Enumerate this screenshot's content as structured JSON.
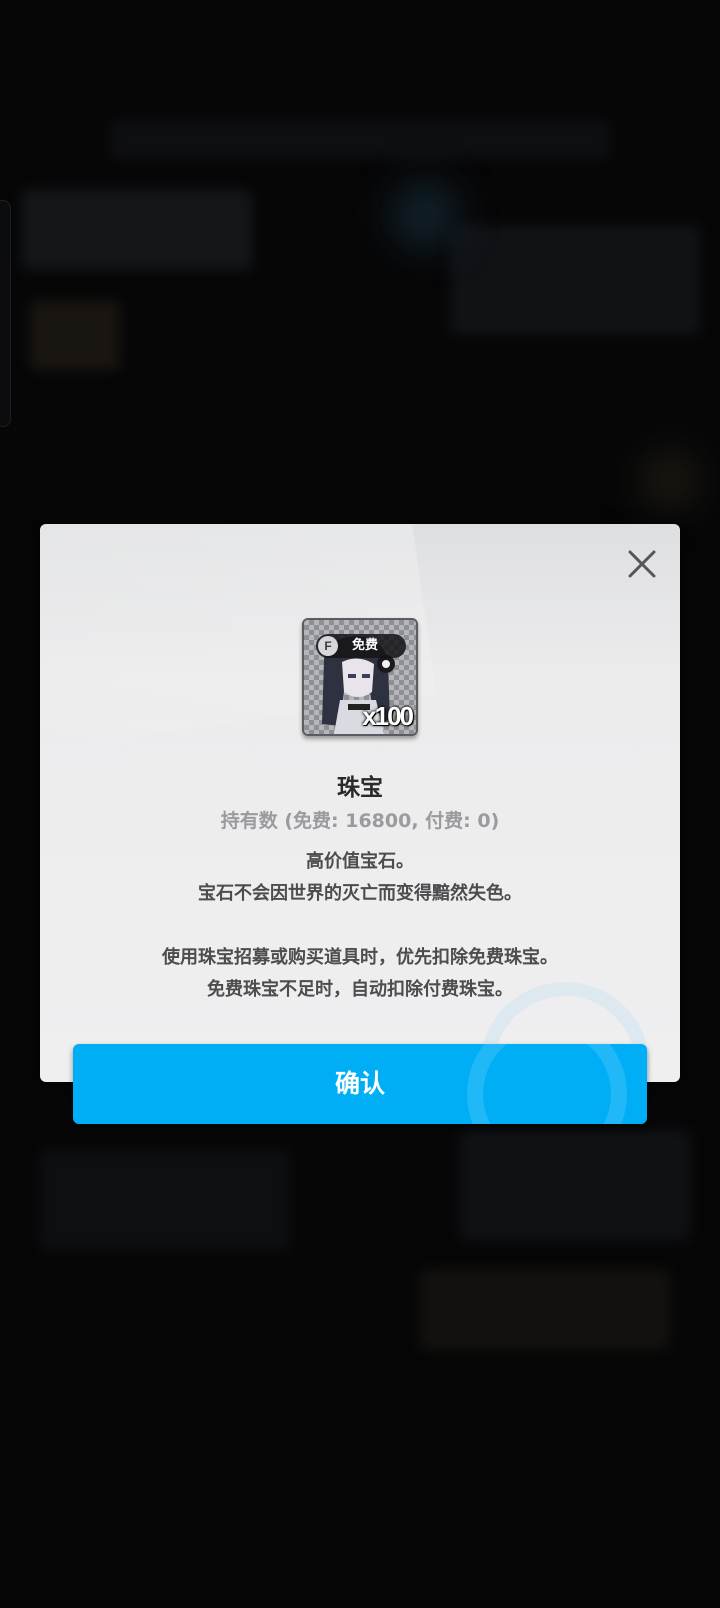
{
  "dialog": {
    "close_icon": "close-icon",
    "item": {
      "badge_letter": "F",
      "badge_label": "免费",
      "quantity": "x100",
      "icon": "character-gem-icon"
    },
    "name": "珠宝",
    "owned": "持有数 (免费: 16800, 付费: 0)",
    "description": [
      "高价值宝石。",
      "宝石不会因世界的灭亡而变得黯然失色。",
      "使用珠宝招募或购买道具时，优先扣除免费珠宝。",
      "免费珠宝不足时，自动扣除付费珠宝。"
    ],
    "confirm_label": "确认"
  },
  "colors": {
    "confirm_button": "#00aef6",
    "dialog_bg": "#efeff0",
    "overlay_bg": "#060607"
  }
}
